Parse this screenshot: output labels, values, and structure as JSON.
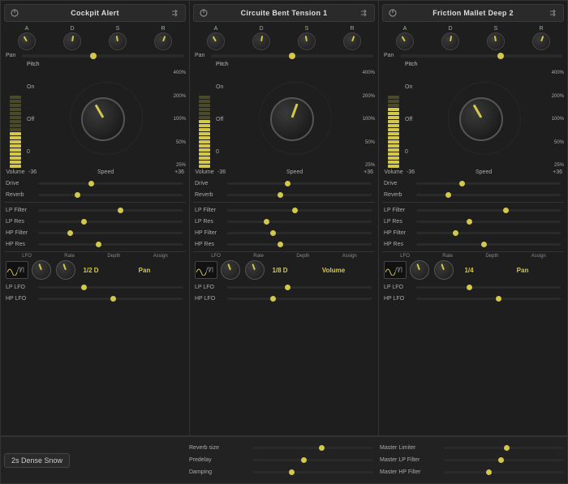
{
  "instruments": [
    {
      "id": "cockpit-alert",
      "title": "Cockpit Alert",
      "panPos": "42%",
      "adsr": {
        "a": "A",
        "d": "D",
        "s": "S",
        "r": "R"
      },
      "drive_pos": "35%",
      "reverb_pos": "25%",
      "lp_filter_pos": "55%",
      "lp_res_pos": "30%",
      "hp_filter_pos": "20%",
      "hp_res_pos": "40%",
      "lfo_time": "1/2 D",
      "lfo_assign": "Pan",
      "lp_lfo_pos": "30%",
      "hp_lfo_pos": "50%",
      "volBars": [
        1,
        1,
        1,
        1,
        1,
        1,
        1,
        1,
        0,
        0,
        0,
        0,
        0,
        0,
        0,
        0,
        0,
        0
      ]
    },
    {
      "id": "circuite-bent-tension",
      "title": "Circuite Bent Tension 1",
      "panPos": "48%",
      "adsr": {
        "a": "A",
        "d": "D",
        "s": "S",
        "r": "R"
      },
      "drive_pos": "40%",
      "reverb_pos": "35%",
      "lp_filter_pos": "45%",
      "lp_res_pos": "25%",
      "hp_filter_pos": "30%",
      "hp_res_pos": "35%",
      "lfo_time": "1/8 D",
      "lfo_assign": "Volume",
      "lp_lfo_pos": "40%",
      "hp_lfo_pos": "30%",
      "volBars": [
        1,
        1,
        1,
        1,
        1,
        1,
        1,
        1,
        1,
        1,
        1,
        1,
        0,
        0,
        0,
        0,
        0,
        0
      ]
    },
    {
      "id": "friction-mallet",
      "title": "Friction Mallet Deep 2",
      "panPos": "60%",
      "adsr": {
        "a": "A",
        "d": "D",
        "s": "S",
        "r": "R"
      },
      "drive_pos": "30%",
      "reverb_pos": "20%",
      "lp_filter_pos": "60%",
      "lp_res_pos": "35%",
      "hp_filter_pos": "25%",
      "hp_res_pos": "45%",
      "lfo_time": "1/4",
      "lfo_assign": "Pan",
      "lp_lfo_pos": "35%",
      "hp_lfo_pos": "55%",
      "volBars": [
        1,
        1,
        1,
        1,
        1,
        1,
        1,
        1,
        1,
        1,
        1,
        1,
        1,
        1,
        1,
        0,
        0,
        0
      ]
    }
  ],
  "bottom": {
    "preset": "2s Dense Snow",
    "reverb_size_pos": "55%",
    "predelay_pos": "40%",
    "damping_pos": "30%",
    "master_limiter_pos": "50%",
    "master_lp_pos": "45%",
    "master_hp_pos": "35%"
  },
  "labels": {
    "pan": "Pan",
    "volume": "Volume",
    "drive": "Drive",
    "reverb": "Reverb",
    "lp_filter": "LP Filter",
    "lp_res": "LP Res",
    "hp_filter": "HP Filter",
    "hp_res": "HP Res",
    "lfo": "LFO",
    "rate": "Rate",
    "depth": "Depth",
    "assign": "Assign",
    "lp_lfo": "LP LFO",
    "hp_lfo": "HP LFO",
    "pitch": "Pitch",
    "on": "On",
    "off": "Off",
    "speed": "Speed",
    "vol_neg": "-36",
    "vol_pos": "+36",
    "pct_400": "400%",
    "pct_200": "200%",
    "pct_100": "100%",
    "pct_50": "50%",
    "pct_25": "25%",
    "reverb_size": "Reverb size",
    "predelay": "Predelay",
    "damping": "Damping",
    "master_limiter": "Master Limiter",
    "master_lp": "Master LP Filter",
    "master_hp": "Master HP Filter"
  }
}
